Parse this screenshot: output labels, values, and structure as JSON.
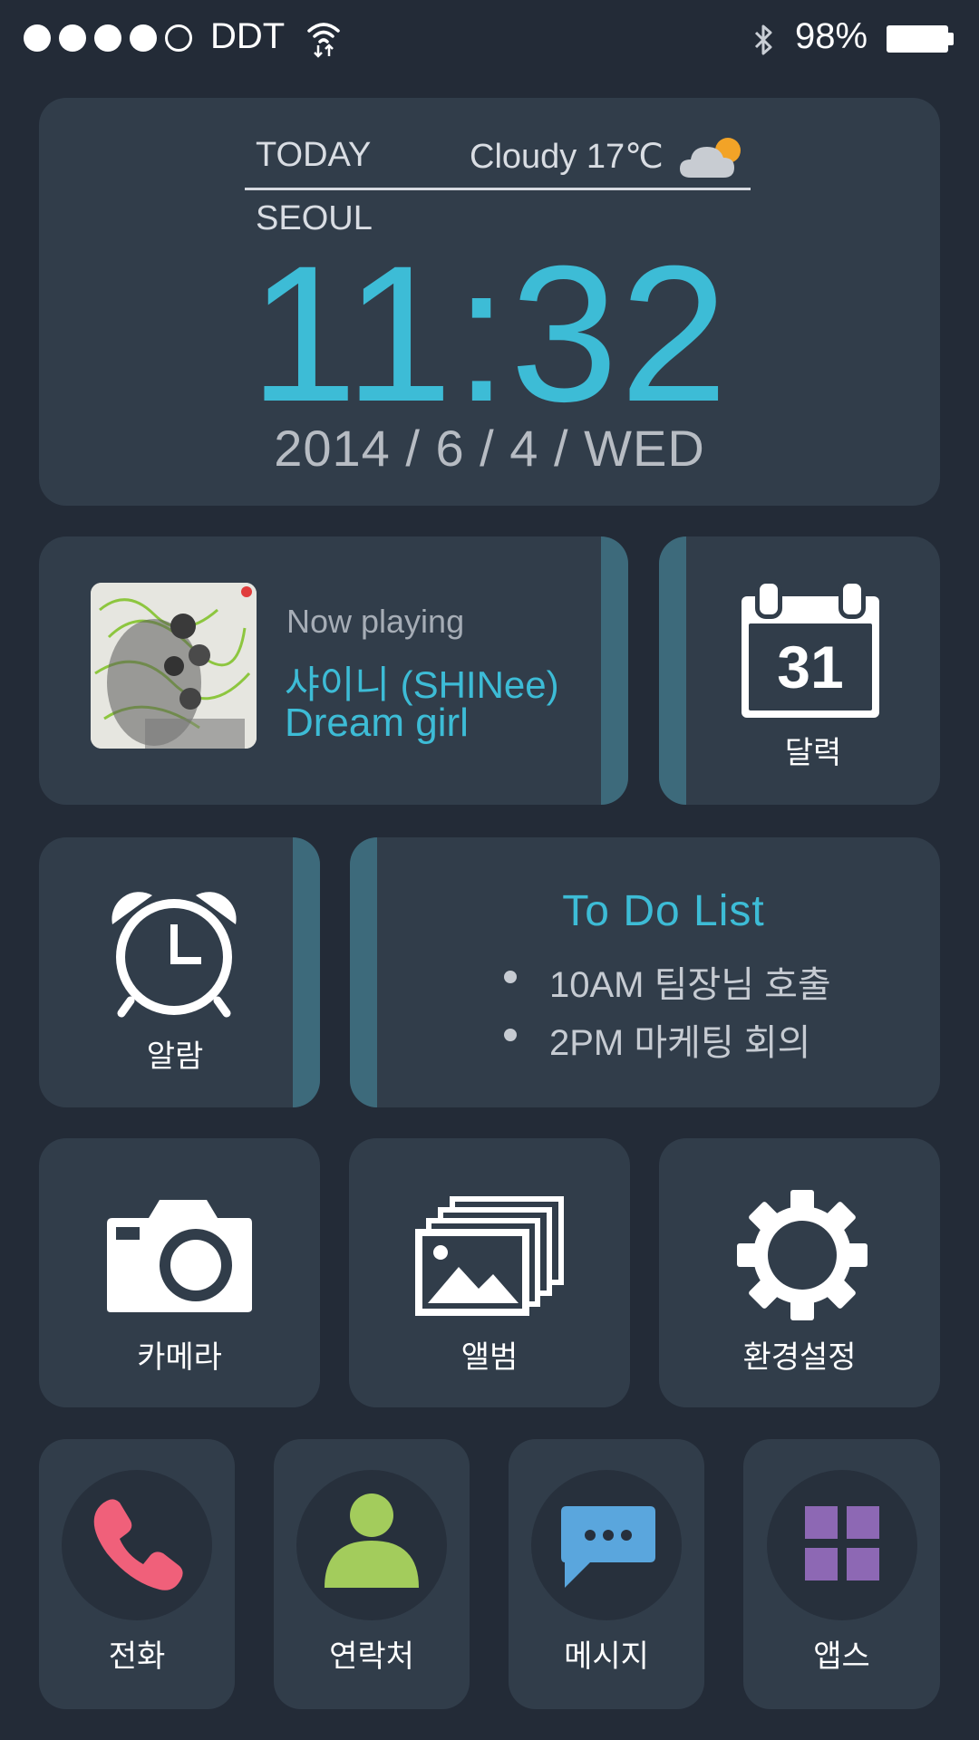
{
  "status_bar": {
    "signal_bars": 4,
    "signal_max": 5,
    "carrier": "DDT",
    "battery_percent": "98%",
    "icons": [
      "wifi-icon",
      "bluetooth-icon",
      "battery-icon"
    ]
  },
  "clock_widget": {
    "today_label": "TODAY",
    "weather": "Cloudy 17℃",
    "weather_icon": "cloud-sun-icon",
    "city": "SEOUL",
    "time": "11:32",
    "date": "2014 / 6 / 4 / WED"
  },
  "music_widget": {
    "now_playing_label": "Now playing",
    "artist": "샤이니 (SHINee)",
    "song": "Dream girl"
  },
  "calendar_widget": {
    "day": "31",
    "label": "달력"
  },
  "alarm_widget": {
    "label": "알람"
  },
  "todo_widget": {
    "title": "To Do List",
    "items": [
      "10AM 팀장님 호출",
      "2PM  마케팅 회의"
    ]
  },
  "apps": [
    {
      "label": "카메라",
      "icon": "camera-icon"
    },
    {
      "label": "앨범",
      "icon": "album-icon"
    },
    {
      "label": "환경설정",
      "icon": "gear-icon"
    }
  ],
  "dock": [
    {
      "label": "전화",
      "icon": "phone-icon",
      "color": "#f0607a"
    },
    {
      "label": "연락처",
      "icon": "contact-icon",
      "color": "#a3cc5c"
    },
    {
      "label": "메시지",
      "icon": "message-icon",
      "color": "#5aa6dd"
    },
    {
      "label": "앱스",
      "icon": "apps-grid-icon",
      "color": "#8d68b4"
    }
  ],
  "colors": {
    "background": "#232b37",
    "card": "#313d4a",
    "accent": "#3dbcd6",
    "accent_bar": "#3d6a7b"
  }
}
